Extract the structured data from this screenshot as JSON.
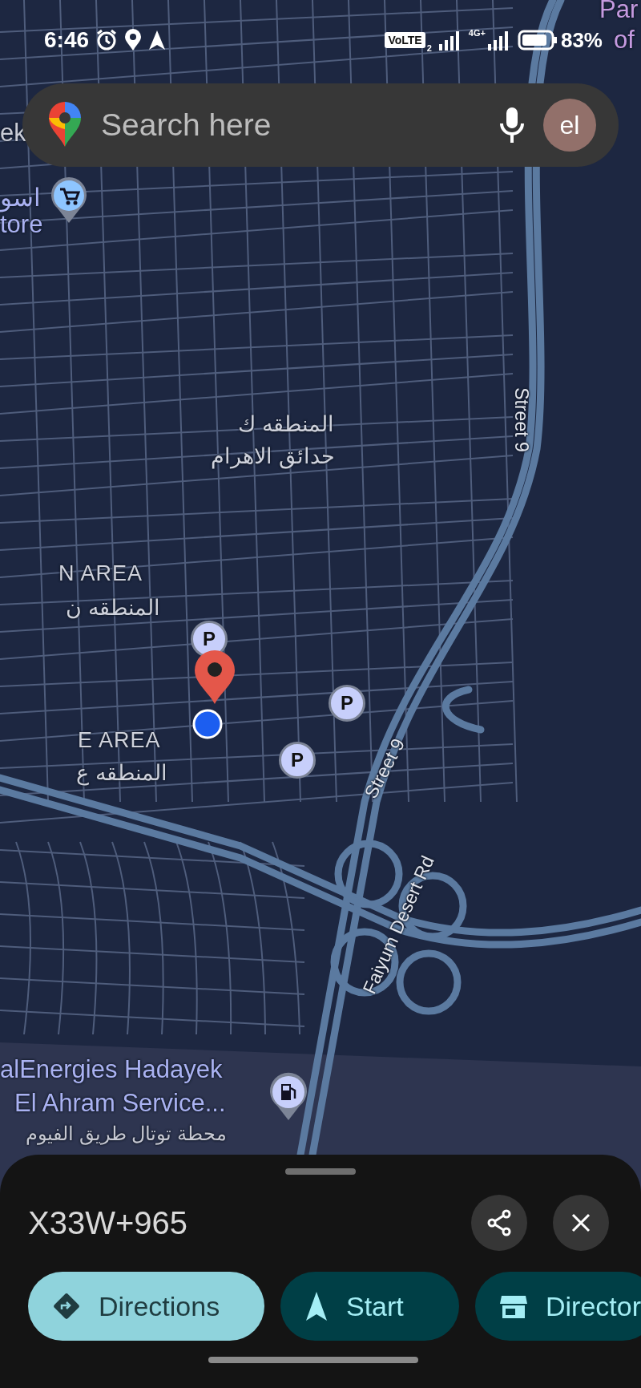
{
  "status_bar": {
    "time": "6:46",
    "volte": "VoLTE",
    "sim": "2",
    "network": "4G+",
    "battery": "83%"
  },
  "search": {
    "placeholder": "Search here",
    "avatar": "el"
  },
  "map": {
    "labels": [
      {
        "text": "Par",
        "kind": "poi_edge"
      },
      {
        "text": "of",
        "kind": "poi_edge"
      },
      {
        "text": "ek",
        "kind": "area_edge"
      },
      {
        "text": "اسو",
        "kind": "poi"
      },
      {
        "text": "tore",
        "kind": "poi"
      },
      {
        "text": "المنطقه ك",
        "kind": "area"
      },
      {
        "text": "حدائق الاهرام",
        "kind": "area"
      },
      {
        "text": "Street 9",
        "kind": "road"
      },
      {
        "text": "N AREA",
        "kind": "area"
      },
      {
        "text": "المنطقه ن",
        "kind": "area"
      },
      {
        "text": "E AREA",
        "kind": "area"
      },
      {
        "text": "المنطقه ع",
        "kind": "area"
      },
      {
        "text": "Street 9",
        "kind": "road"
      },
      {
        "text": "Faiyum Desert Rd",
        "kind": "road"
      },
      {
        "text": "alEnergies Hadayek",
        "kind": "poi"
      },
      {
        "text": "El Ahram Service...",
        "kind": "poi"
      },
      {
        "text": "محطة توتال طريق الفيوم",
        "kind": "poi_ar"
      }
    ],
    "pins": [
      {
        "kind": "shop"
      },
      {
        "kind": "parking",
        "text": "P"
      },
      {
        "kind": "parking",
        "text": "P"
      },
      {
        "kind": "parking",
        "text": "P"
      },
      {
        "kind": "place"
      },
      {
        "kind": "me"
      },
      {
        "kind": "fuel"
      }
    ]
  },
  "sheet": {
    "title": "X33W+965",
    "chips": [
      {
        "label": "Directions",
        "kind": "directions"
      },
      {
        "label": "Start",
        "kind": "start"
      },
      {
        "label": "Director",
        "kind": "directory"
      }
    ]
  }
}
